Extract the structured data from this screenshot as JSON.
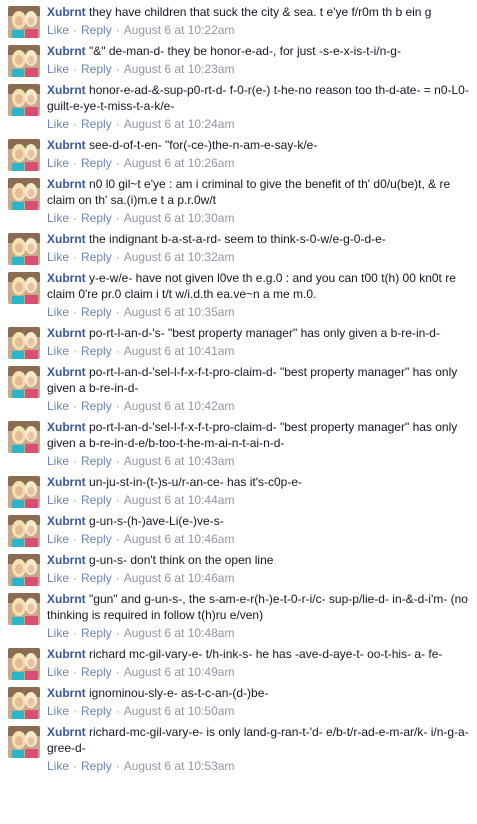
{
  "labels": {
    "like": "Like",
    "reply": "Reply",
    "separator": "·"
  },
  "comments": [
    {
      "author": "Xubrnt",
      "text": "they have children that suck the city & sea. t e'ye f/r0m th b ein g",
      "time": "August 6 at 10:22am"
    },
    {
      "author": "Xubrnt",
      "text": "\"&\" de-man-d- they be honor-e-ad-, for just -s-e-x-is-t-i/n-g-",
      "time": "August 6 at 10:23am"
    },
    {
      "author": "Xubrnt",
      "text": "honor-e-ad-&-sup-p0-rt-d- f-0-r(e-) t-he-no reason too th-d-ate- = n0-L0-guilt-e-ye-t-miss-t-a-k/e-",
      "time": "August 6 at 10:24am"
    },
    {
      "author": "Xubrnt",
      "text": "see-d-of-t-en- \"for(-ce-)the-n-am-e-say-k/e-",
      "time": "August 6 at 10:26am"
    },
    {
      "author": "Xubrnt",
      "text": "n0 l0 gil~t e'ye : am i criminal to give the benefit of th' d0/u(be)t, & re claim on th' sa.(i)m.e t a p.r.0w/t",
      "time": "August 6 at 10:30am"
    },
    {
      "author": "Xubrnt",
      "text": "the indignant b-a-st-a-rd- seem to think-s-0-w/e-g-0-d-e-",
      "time": "August 6 at 10:32am"
    },
    {
      "author": "Xubrnt",
      "text": "y-e-w/e- have not given l0ve th e.g.0 : and you can t00 t(h) 00 kn0t re claim 0're pr.0 claim i t/t w/i.d.th ea.ve~n a me m.0.",
      "time": "August 6 at 10:35am"
    },
    {
      "author": "Xubrnt",
      "text": "po-rt-l-an-d-'s- \"best property manager\" has only given a b-re-in-d-",
      "time": "August 6 at 10:41am"
    },
    {
      "author": "Xubrnt",
      "text": "po-rt-l-an-d-'sel-l-f-x-f-t-pro-claim-d- \"best property manager\" has only given a b-re-in-d-",
      "time": "August 6 at 10:42am"
    },
    {
      "author": "Xubrnt",
      "text": "po-rt-l-an-d-'sel-l-f-x-f-t-pro-claim-d- \"best property manager\" has only given a b-re-in-d-e/b-too-t-he-m-ai-n-t-ai-n-d-",
      "time": "August 6 at 10:43am"
    },
    {
      "author": "Xubrnt",
      "text": "un-ju-st-in-(t-)s-u/r-an-ce- has it's-c0p-e-",
      "time": "August 6 at 10:44am"
    },
    {
      "author": "Xubrnt",
      "text": "g-un-s-(h-)ave-Li(e-)ve-s-",
      "time": "August 6 at 10:46am"
    },
    {
      "author": "Xubrnt",
      "text": "g-un-s- don't think on the open line",
      "time": "August 6 at 10:46am"
    },
    {
      "author": "Xubrnt",
      "text": "\"gun\" and g-un-s-, the s-am-e-r(h-)e-t-0-r-i/c- sup-p/lie-d- in-&-d-i'm- (no thinking is required in follow t(h)ru e/ven)",
      "time": "August 6 at 10:48am"
    },
    {
      "author": "Xubrnt",
      "text": "richard mc-gil-vary-e- t/h-ink-s- he has -ave-d-aye-t- oo-t-his- a- fe-",
      "time": "August 6 at 10:49am"
    },
    {
      "author": "Xubrnt",
      "text": "ignominou-sly-e- as-t-c-an-(d-)be-",
      "time": "August 6 at 10:50am"
    },
    {
      "author": "Xubrnt",
      "text": "richard-mc-gil-vary-e- is only land-g-ran-t-'d- e/b-t/r-ad-e-m-ar/k- i/n-g-a-gree-d-",
      "time": "August 6 at 10:53am"
    }
  ]
}
